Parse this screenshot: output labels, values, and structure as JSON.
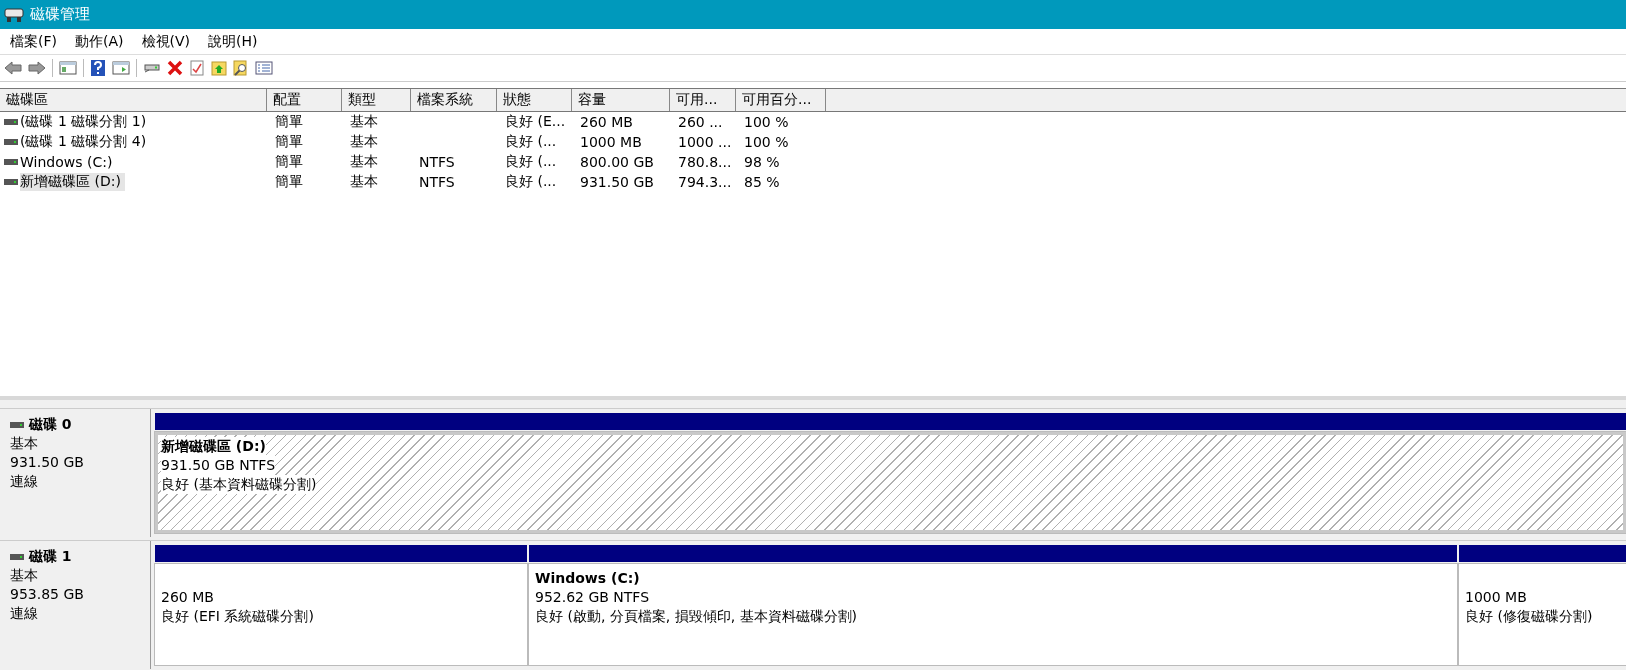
{
  "window": {
    "title": "磁碟管理"
  },
  "menu": [
    "檔案(F)",
    "動作(A)",
    "檢視(V)",
    "說明(H)"
  ],
  "table": {
    "columns": [
      "磁碟區",
      "配置",
      "類型",
      "檔案系統",
      "狀態",
      "容量",
      "可用...",
      "可用百分..."
    ],
    "rows": [
      {
        "cells": [
          "(磁碟 1 磁碟分割 1)",
          "簡單",
          "基本",
          "",
          "良好 (E...",
          "260 MB",
          "260 ...",
          "100 %"
        ],
        "selected": false
      },
      {
        "cells": [
          "(磁碟 1 磁碟分割 4)",
          "簡單",
          "基本",
          "",
          "良好 (...",
          "1000 MB",
          "1000 ...",
          "100 %"
        ],
        "selected": false
      },
      {
        "cells": [
          "Windows (C:)",
          "簡單",
          "基本",
          "NTFS",
          "良好 (...",
          "800.00 GB",
          "780.8...",
          "98 %"
        ],
        "selected": false
      },
      {
        "cells": [
          "新增磁碟區 (D:)",
          "簡單",
          "基本",
          "NTFS",
          "良好 (...",
          "931.50 GB",
          "794.3...",
          "85 %"
        ],
        "selected": true
      }
    ]
  },
  "disks": [
    {
      "name": "磁碟 0",
      "type": "基本",
      "size": "931.50 GB",
      "status": "連線",
      "partitions": [
        {
          "name": "新增磁碟區  (D:)",
          "size": "931.50 GB NTFS",
          "status": "良好 (基本資料磁碟分割)",
          "selected": true
        }
      ]
    },
    {
      "name": "磁碟 1",
      "type": "基本",
      "size": "953.85 GB",
      "status": "連線",
      "partitions": [
        {
          "size": "260 MB",
          "status": "良好 (EFI 系統磁碟分割)",
          "selected": false
        },
        {
          "name": "Windows  (C:)",
          "size": "952.62 GB NTFS",
          "status": "良好 (啟動, 分頁檔案, 損毀傾印, 基本資料磁碟分割)",
          "selected": false
        },
        {
          "size": "1000 MB",
          "status": "良好 (修復磁碟分割)",
          "selected": false
        }
      ]
    }
  ]
}
